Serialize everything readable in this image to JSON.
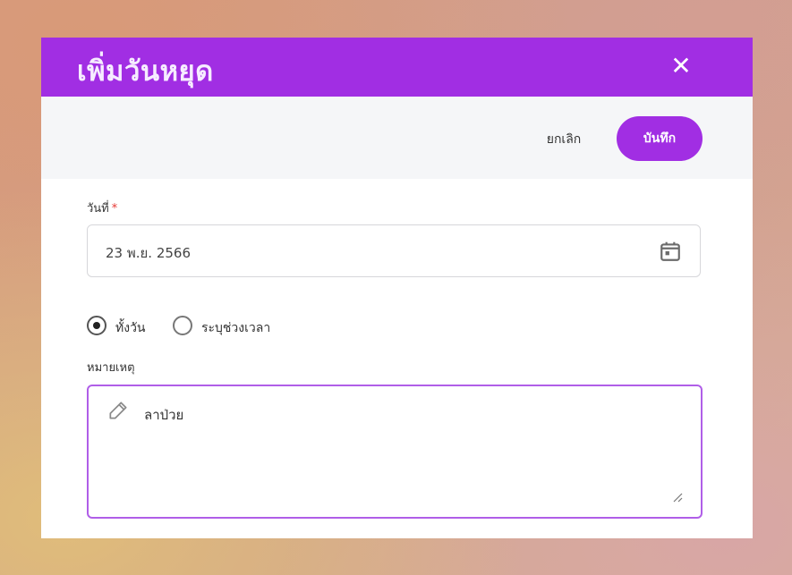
{
  "dialog": {
    "title": "เพิ่มวันหยุด",
    "close_icon": "close-icon",
    "accent_color": "#a12ee3"
  },
  "toolbar": {
    "cancel_label": "ยกเลิก",
    "save_label": "บันทึก"
  },
  "form": {
    "date": {
      "label": "วันที่",
      "required_marker": "*",
      "value": "23 พ.ย. 2566",
      "icon": "calendar-icon"
    },
    "duration": {
      "options": [
        {
          "label": "ทั้งวัน",
          "selected": true
        },
        {
          "label": "ระบุช่วงเวลา",
          "selected": false
        }
      ]
    },
    "note": {
      "label": "หมายเหตุ",
      "value": "ลาป่วย",
      "icon": "edit-pencil-icon"
    }
  }
}
